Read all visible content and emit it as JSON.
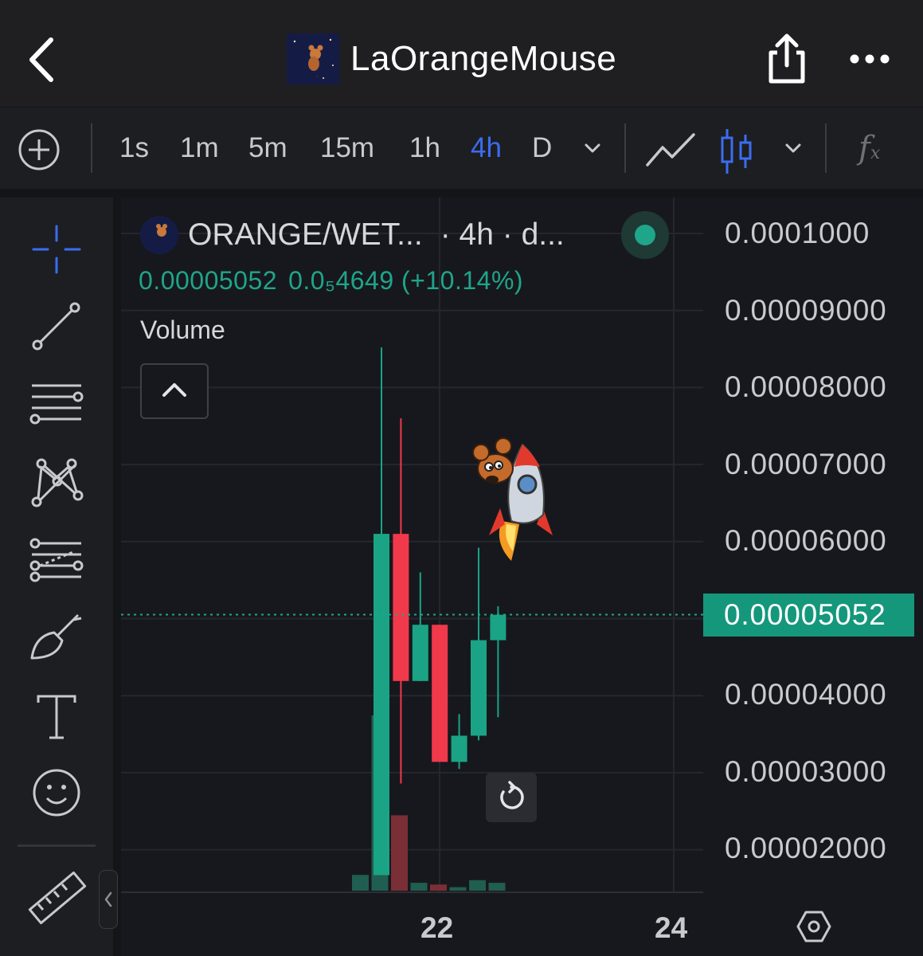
{
  "header": {
    "title": "LaOrangeMouse",
    "back_icon": "chevron-left-icon",
    "share_icon": "share-icon",
    "more_icon": "more-horizontal-icon"
  },
  "toolbar": {
    "timeframes": [
      "1s",
      "1m",
      "5m",
      "15m",
      "1h",
      "4h",
      "D"
    ],
    "active_timeframe": "4h",
    "fx_label": "f",
    "fx_sub": "x"
  },
  "chart": {
    "symbol": "ORANGE/WET...",
    "interval_text": "· 4h · d...",
    "last_price": "0.00005052",
    "change_text": "0.0₅4649 (+10.14%)",
    "volume_label": "Volume",
    "y_axis_labels": [
      "0.0001000",
      "0.00009000",
      "0.00008000",
      "0.00007000",
      "0.00006000",
      "0.00004000",
      "0.00003000",
      "0.00002000"
    ],
    "current_price_tag": "0.00005052",
    "x_axis_labels": [
      "22",
      "24"
    ],
    "colors": {
      "up": "#1aa485",
      "down": "#f0394b",
      "accent": "#3a6df0",
      "background": "#17181d"
    }
  },
  "chart_data": {
    "type": "candlestick",
    "title": "",
    "x_ticks": [
      "22",
      "24"
    ],
    "ylim": [
      1.4e-05,
      0.000107
    ],
    "last_price": 5.052e-05,
    "candles": [
      {
        "open": 1.67e-05,
        "high": 8.52e-05,
        "low": 1.67e-05,
        "close": 6.1e-05,
        "direction": "up"
      },
      {
        "open": 6.1e-05,
        "high": 7.6e-05,
        "low": 2.86e-05,
        "close": 4.19e-05,
        "direction": "down"
      },
      {
        "open": 4.19e-05,
        "high": 5.6e-05,
        "low": 4.19e-05,
        "close": 4.92e-05,
        "direction": "up"
      },
      {
        "open": 4.92e-05,
        "high": 4.92e-05,
        "low": 3.14e-05,
        "close": 3.14e-05,
        "direction": "down"
      },
      {
        "open": 3.14e-05,
        "high": 3.76e-05,
        "low": 3.05e-05,
        "close": 3.48e-05,
        "direction": "up"
      },
      {
        "open": 3.48e-05,
        "high": 5.92e-05,
        "low": 3.42e-05,
        "close": 4.72e-05,
        "direction": "up"
      },
      {
        "open": 4.72e-05,
        "high": 5.16e-05,
        "low": 3.72e-05,
        "close": 5.05e-05,
        "direction": "up"
      }
    ],
    "volume": [
      {
        "value": 0.09,
        "direction": "up"
      },
      {
        "value": 1.0,
        "direction": "up"
      },
      {
        "value": 0.43,
        "direction": "down"
      },
      {
        "value": 0.045,
        "direction": "up"
      },
      {
        "value": 0.035,
        "direction": "down"
      },
      {
        "value": 0.02,
        "direction": "up"
      },
      {
        "value": 0.06,
        "direction": "up"
      },
      {
        "value": 0.045,
        "direction": "up"
      }
    ]
  }
}
